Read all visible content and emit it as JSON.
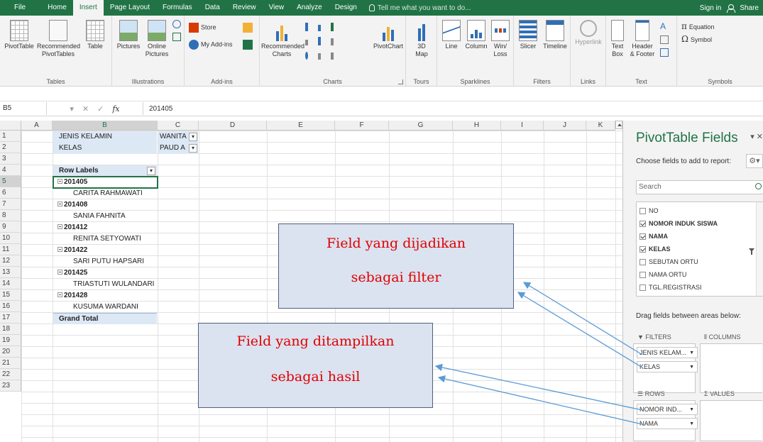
{
  "tabs": [
    "File",
    "Home",
    "Insert",
    "Page Layout",
    "Formulas",
    "Data",
    "Review",
    "View",
    "Analyze",
    "Design"
  ],
  "active_tab": "Insert",
  "tell_me": "Tell me what you want to do...",
  "sign_in": "Sign in",
  "share": "Share",
  "ribbon": {
    "tables": {
      "pivot": "PivotTable",
      "recommended": "Recommended",
      "recommended2": "PivotTables",
      "table": "Table",
      "label": "Tables"
    },
    "illustrations": {
      "pictures": "Pictures",
      "online": "Online",
      "online2": "Pictures",
      "label": "Illustrations"
    },
    "addins": {
      "store": "Store",
      "myaddins": "My Add-ins",
      "label": "Add-ins"
    },
    "charts": {
      "recommended": "Recommended",
      "recommended2": "Charts",
      "pivotchart": "PivotChart",
      "label": "Charts"
    },
    "tours": {
      "map": "3D",
      "map2": "Map",
      "label": "Tours"
    },
    "sparklines": {
      "line": "Line",
      "column": "Column",
      "winloss": "Win/",
      "winloss2": "Loss",
      "label": "Sparklines"
    },
    "filters": {
      "slicer": "Slicer",
      "timeline": "Timeline",
      "label": "Filters"
    },
    "links": {
      "hyperlink": "Hyperlink",
      "label": "Links"
    },
    "text": {
      "textbox": "Text",
      "textbox2": "Box",
      "header": "Header",
      "header2": "& Footer",
      "label": "Text"
    },
    "symbols": {
      "equation": "Equation",
      "symbol": "Symbol",
      "label": "Symbols"
    }
  },
  "formula_bar": {
    "name_box": "B5",
    "fx": "fx",
    "value": "201405"
  },
  "columns": [
    "A",
    "B",
    "C",
    "D",
    "E",
    "F",
    "G",
    "H",
    "I",
    "J",
    "K"
  ],
  "rows": [
    "1",
    "2",
    "3",
    "4",
    "5",
    "6",
    "7",
    "8",
    "9",
    "10",
    "11",
    "12",
    "13",
    "14",
    "15",
    "16",
    "17",
    "18",
    "19",
    "20",
    "21",
    "22",
    "23"
  ],
  "pivot": {
    "filter1_label": "JENIS KELAMIN",
    "filter1_value": "WANITA",
    "filter2_label": "KELAS",
    "filter2_value": "PAUD A",
    "row_labels": "Row Labels",
    "items": [
      {
        "id": "201405",
        "name": "CARITA RAHMAWATI"
      },
      {
        "id": "201408",
        "name": "SANIA FAHNITA"
      },
      {
        "id": "201412",
        "name": "RENITA SETYOWATI"
      },
      {
        "id": "201422",
        "name": "SARI PUTU HAPSARI"
      },
      {
        "id": "201425",
        "name": "TRIASTUTI WULANDARI"
      },
      {
        "id": "201428",
        "name": "KUSUMA WARDANI"
      }
    ],
    "grand_total": "Grand Total"
  },
  "pane": {
    "title": "PivotTable Fields",
    "subtitle": "Choose fields to add to report:",
    "search_placeholder": "Search",
    "fields": [
      {
        "name": "NO",
        "checked": false,
        "bold": false
      },
      {
        "name": "NOMOR INDUK SISWA",
        "checked": true,
        "bold": true
      },
      {
        "name": "NAMA",
        "checked": true,
        "bold": true
      },
      {
        "name": "KELAS",
        "checked": true,
        "bold": true
      },
      {
        "name": "SEBUTAN ORTU",
        "checked": false,
        "bold": false
      },
      {
        "name": "NAMA ORTU",
        "checked": false,
        "bold": false
      },
      {
        "name": "TGL.REGISTRASI",
        "checked": false,
        "bold": false
      }
    ],
    "drag_label": "Drag fields between areas below:",
    "filters_head": "FILTERS",
    "columns_head": "COLUMNS",
    "rows_head": "ROWS",
    "values_head": "VALUES",
    "filter_items": [
      "JENIS KELAM...",
      "KELAS"
    ],
    "row_items": [
      "NOMOR IND...",
      "NAMA"
    ]
  },
  "callout_filter": {
    "line1": "Field yang dijadikan",
    "line2": "sebagai filter"
  },
  "callout_result": {
    "line1": "Field yang ditampilkan",
    "line2": "sebagai hasil"
  },
  "colors": {
    "excel_green": "#217346",
    "pivot_blue": "#dde8f5",
    "callout_fill": "#dbe2f0",
    "callout_text": "#e00000",
    "arrow": "#5b9bd5"
  }
}
